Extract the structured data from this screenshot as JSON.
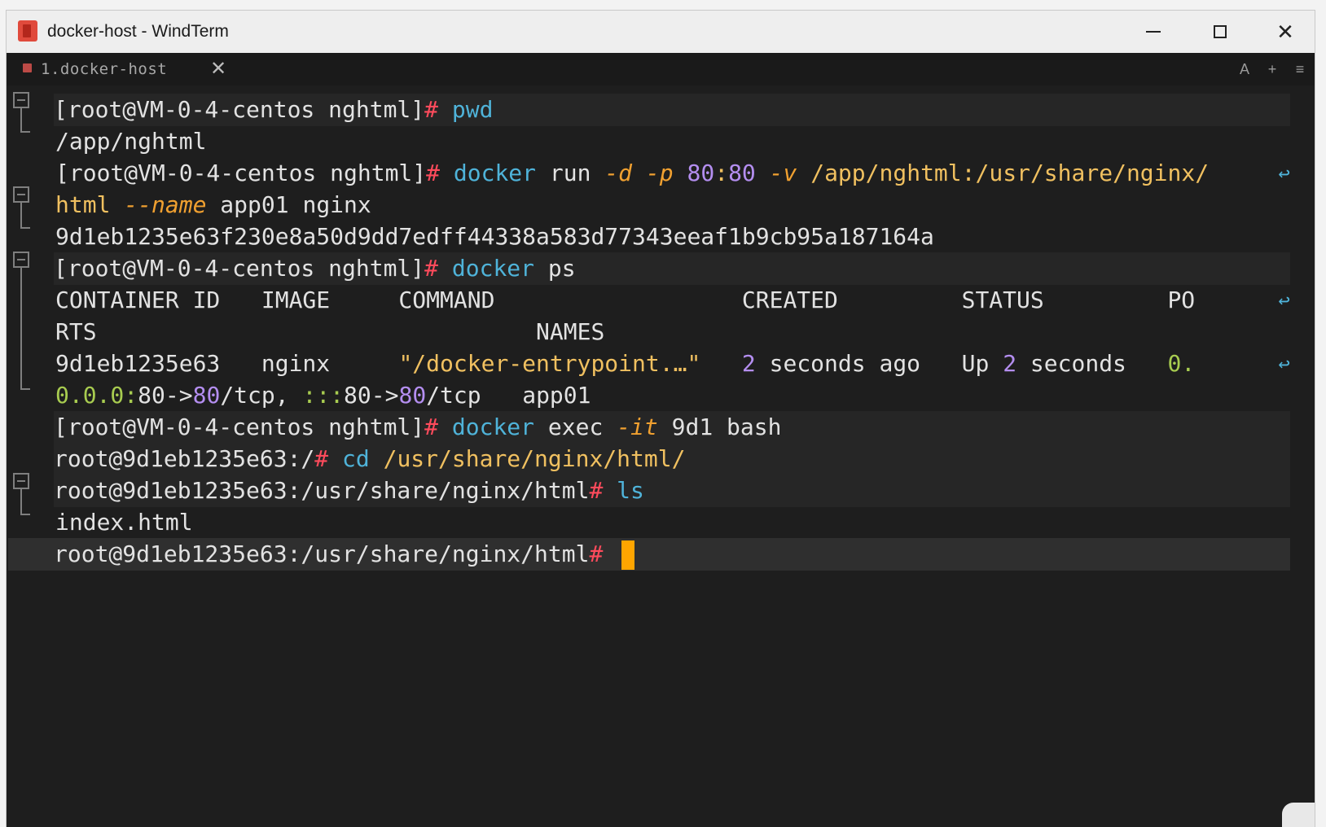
{
  "window": {
    "title": "docker-host - WindTerm"
  },
  "tab": {
    "label": "1.docker-host",
    "close": "✕"
  },
  "tab_tools": [
    "A",
    "+",
    "≡"
  ],
  "colors": {
    "prompt": "#ff4b5c",
    "command": "#4fb3d9",
    "option": "#f0a030",
    "number": "#b48ef0",
    "cursor": "#ffa500"
  },
  "terminal": {
    "lines": [
      {
        "segments": [
          [
            "c-white",
            "[root@VM-0-4-centos nghtml]"
          ],
          [
            "c-prompt",
            "# "
          ],
          [
            "c-cmd",
            "pwd"
          ]
        ]
      },
      {
        "segments": [
          [
            "c-white",
            "/app/nghtml"
          ]
        ]
      },
      {
        "segments": [
          [
            "c-white",
            "[root@VM-0-4-centos nghtml]"
          ],
          [
            "c-prompt",
            "# "
          ],
          [
            "c-cmd",
            "docker"
          ],
          [
            "c-white",
            " run "
          ],
          [
            "c-opt",
            "-d"
          ],
          [
            "c-white",
            " "
          ],
          [
            "c-opt",
            "-p"
          ],
          [
            "c-white",
            " "
          ],
          [
            "c-num",
            "80"
          ],
          [
            "c-path",
            ":"
          ],
          [
            "c-num",
            "80"
          ],
          [
            "c-white",
            " "
          ],
          [
            "c-opt",
            "-v"
          ],
          [
            "c-white",
            " "
          ],
          [
            "c-path",
            "/app/nghtml:/usr/share/nginx/"
          ]
        ],
        "wrap": true
      },
      {
        "segments": [
          [
            "c-path",
            "html"
          ],
          [
            "c-white",
            " "
          ],
          [
            "c-opt",
            "--name"
          ],
          [
            "c-white",
            " app01 nginx"
          ]
        ]
      },
      {
        "segments": [
          [
            "c-white",
            "9d1eb1235e63f230e8a50d9dd7edff44338a583d77343eeaf1b9cb95a187164a"
          ]
        ]
      },
      {
        "segments": [
          [
            "c-white",
            "[root@VM-0-4-centos nghtml]"
          ],
          [
            "c-prompt",
            "# "
          ],
          [
            "c-cmd",
            "docker"
          ],
          [
            "c-white",
            " ps"
          ]
        ]
      },
      {
        "segments": [
          [
            "c-white",
            "CONTAINER ID   IMAGE     COMMAND                  CREATED         STATUS         PO"
          ]
        ],
        "wrap": true
      },
      {
        "segments": [
          [
            "c-white",
            "RTS                                NAMES"
          ]
        ]
      },
      {
        "segments": [
          [
            "c-white",
            "9d1eb1235e63   nginx     "
          ],
          [
            "c-path",
            "\"/docker-entrypoint.…\""
          ],
          [
            "c-white",
            "   "
          ],
          [
            "c-num",
            "2"
          ],
          [
            "c-white",
            " seconds ago   Up "
          ],
          [
            "c-num",
            "2"
          ],
          [
            "c-white",
            " seconds   "
          ],
          [
            "c-ip",
            "0."
          ]
        ],
        "wrap": true
      },
      {
        "segments": [
          [
            "c-ip",
            "0.0.0:"
          ],
          [
            "c-white",
            "80->"
          ],
          [
            "c-num",
            "80"
          ],
          [
            "c-white",
            "/tcp, "
          ],
          [
            "c-ip",
            ":::"
          ],
          [
            "c-white",
            "80->"
          ],
          [
            "c-num",
            "80"
          ],
          [
            "c-white",
            "/tcp   app01"
          ]
        ]
      },
      {
        "segments": [
          [
            "c-white",
            "[root@VM-0-4-centos nghtml]"
          ],
          [
            "c-prompt",
            "# "
          ],
          [
            "c-cmd",
            "docker"
          ],
          [
            "c-white",
            " exec "
          ],
          [
            "c-opt",
            "-it"
          ],
          [
            "c-white",
            " 9d1 bash"
          ]
        ]
      },
      {
        "segments": [
          [
            "c-white",
            "root@9d1eb1235e63:/"
          ],
          [
            "c-prompt",
            "# "
          ],
          [
            "c-cmd",
            "cd"
          ],
          [
            "c-white",
            " "
          ],
          [
            "c-path",
            "/usr/share/nginx/html/"
          ]
        ]
      },
      {
        "segments": [
          [
            "c-white",
            "root@9d1eb1235e63:/usr/share/nginx/html"
          ],
          [
            "c-prompt",
            "# "
          ],
          [
            "c-cmd",
            "ls"
          ]
        ]
      },
      {
        "segments": [
          [
            "c-white",
            "index.html"
          ]
        ]
      },
      {
        "segments": [
          [
            "c-white",
            "root@9d1eb1235e63:/usr/share/nginx/html"
          ],
          [
            "c-prompt",
            "# "
          ]
        ],
        "cursor": true
      }
    ]
  }
}
